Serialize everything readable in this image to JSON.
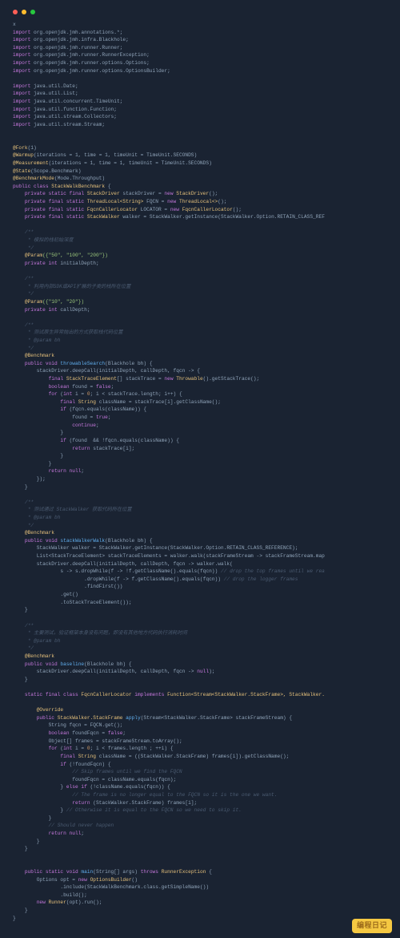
{
  "titlebar": {
    "dots": [
      "close",
      "min",
      "max"
    ]
  },
  "badge": "编程日记",
  "code": {
    "l00": "x",
    "imp": "import",
    "i01": " org.openjdk.jmh.annotations.*;",
    "i02": " org.openjdk.jmh.infra.Blackhole;",
    "i03": " org.openjdk.jmh.runner.Runner;",
    "i04": " org.openjdk.jmh.runner.RunnerException;",
    "i05": " org.openjdk.jmh.runner.options.Options;",
    "i06": " org.openjdk.jmh.runner.options.OptionsBuilder;",
    "i07": " java.util.Date;",
    "i08": " java.util.List;",
    "i09": " java.util.concurrent.TimeUnit;",
    "i10": " java.util.function.Function;",
    "i11": " java.util.stream.Collectors;",
    "i12": " java.util.stream.Stream;",
    "a_fork": "@Fork",
    "a_fork_v": "(1)",
    "a_warm": "@Warmup",
    "a_warm_v": "(iterations = 1, time = 1, timeUnit = TimeUnit.SECONDS)",
    "a_meas": "@Measurement",
    "a_meas_v": "(iterations = 1, time = 1, timeUnit = TimeUnit.SECONDS)",
    "a_state": "@State",
    "a_state_v": "(Scope.Benchmark)",
    "a_mode": "@BenchmarkMode",
    "a_mode_v": "(Mode.Throughput)",
    "cls_decl1": "public class",
    "cls_name": " StackWalkBenchmark",
    "f1a": "    private static final ",
    "f1b": "StackDriver",
    "f1c": " stackDriver = ",
    "f1d": "new ",
    "f1e": "StackDriver",
    "f1f": "();",
    "f2a": "    private final static ",
    "f2b": "ThreadLocal<String>",
    "f2c": " FQCN = ",
    "f2d": "new ",
    "f2e": "ThreadLocal<>",
    "f2f": "();",
    "f3a": "    private final static ",
    "f3b": "FqcnCallerLocator",
    "f3c": " LOCATOR = ",
    "f3d": "new ",
    "f3e": "FqcnCallerLocator",
    "f3f": "();",
    "f4a": "    private final static ",
    "f4b": "StackWalker",
    "f4c": " walker = StackWalker.getInstance(StackWalker.Option.RETAIN_CLASS_REF",
    "c1a": "    /**",
    "c1b": "     * 模拟的栈初始深度",
    "c1c": "     */",
    "p1a": "    @Param",
    "p1b": "({\"50\", \"100\", \"200\"})",
    "p1c": "    private int",
    "p1d": " initialDepth;",
    "c2a": "    /**",
    "c2b": "     * 利用内部SDK或API扩展的子类的栈所在位置",
    "c2c": "     */",
    "p2a": "    @Param",
    "p2b": "({\"10\", \"20\"})",
    "p2c": "    private int",
    "p2d": " callDepth;",
    "c3a": "    /**",
    "c3b": "     * 测试原生异常抛出的方式获取栈代码位置",
    "c3c": "     * @param bh",
    "c3d": "     */",
    "bench": "    @Benchmark",
    "m1a": "    public void ",
    "m1b": "throwableSearch",
    "m1c": "(Blackhole bh) {",
    "m1d": "        stackDriver.deepCall(initialDepth, callDepth, fqcn -> {",
    "m1e": "            final ",
    "m1e2": "StackTraceElement",
    "m1e3": "[] stackTrace = ",
    "m1e4": "new ",
    "m1e5": "Throwable",
    "m1e6": "().getStackTrace();",
    "m1f": "            boolean",
    "m1f2": " found = ",
    "m1f3": "false",
    "m1f4": ";",
    "m1g": "            for",
    "m1g2": " (",
    "m1g3": "int",
    "m1g4": " i = ",
    "m1g5": "0",
    "m1g6": "; i < stackTrace.length; i++) {",
    "m1h": "                final ",
    "m1h2": "String",
    "m1h3": " className = stackTrace[i].getClassName();",
    "m1i": "                if",
    "m1i2": " (fqcn.equals(className)) {",
    "m1j": "                    found = ",
    "m1j2": "true",
    "m1j3": ";",
    "m1k": "                    continue",
    "m1k2": ";",
    "m1l": "                }",
    "m1m": "                if",
    "m1m2": " (found  && !fqcn.equals(className)) {",
    "m1n": "                    return",
    "m1n2": " stackTrace[i];",
    "m1o": "                }",
    "m1p": "            }",
    "m1q": "            return null",
    "m1q2": ";",
    "m1r": "        });",
    "m1s": "    }",
    "c4a": "    /**",
    "c4b": "     * 测试通过 StackWalker 获取代码所在位置",
    "c4c": "     * @param bh",
    "c4d": "     */",
    "m2a": "    public void ",
    "m2b": "stackWalkerWalk",
    "m2c": "(Blackhole bh) {",
    "m2d": "        StackWalker walker = StackWalker.getInstance(StackWalker.Option.RETAIN_CLASS_REFERENCE);",
    "m2e": "        List<StackTraceElement> stackTraceElements = walker.walk(stackFrameStream -> stackFrameStream.map",
    "m2f": "        stackDriver.deepCall(initialDepth, callDepth, fqcn -> walker.walk(",
    "m2g": "                s -> s.dropWhile(f -> !f.getClassName().equals(fqcn))",
    "m2g_c": " // drop the top frames until we rea",
    "m2h": "                        .dropWhile(f -> f.getClassName().equals(fqcn))",
    "m2h_c": " // drop the logger frames",
    "m2i": "                        .findFirst())",
    "m2j": "                .get()",
    "m2k": "                .toStackTraceElement());",
    "m2l": "    }",
    "c5a": "    /**",
    "c5b": "     * 主要测试，验证框架本身没有问题，即没有其他地方代码执行消耗时间",
    "c5c": "     * @param bh",
    "c5d": "     */",
    "m3a": "    public void ",
    "m3b": "baseline",
    "m3c": "(Blackhole bh) {",
    "m3d": "        stackDriver.deepCall(initialDepth, callDepth, fqcn -> ",
    "m3d2": "null",
    "m3d3": ");",
    "m3e": "    }",
    "inn1": "    static final class ",
    "inn2": "FqcnCallerLocator",
    "inn3": " implements ",
    "inn4": "Function<Stream<StackWalker.StackFrame>, StackWalker.",
    "ov": "        @Override",
    "ap1": "        public ",
    "ap2": "StackWalker.StackFrame ",
    "ap3": "apply",
    "ap4": "(Stream<StackWalker.StackFrame> stackFrameStream) {",
    "ap5": "            String fqcn = FQCN.get();",
    "ap6": "            boolean",
    "ap6b": " foundFqcn = ",
    "ap6c": "false",
    "ap6d": ";",
    "ap7": "            Object[] frames = stackFrameStream.toArray();",
    "ap8": "            for",
    "ap8b": " (",
    "ap8c": "int",
    "ap8d": " i = ",
    "ap8e": "0",
    "ap8f": "; i < frames.length ; ++i) {",
    "ap9": "                final ",
    "ap9b": "String",
    "ap9c": " className = ((StackWalker.StackFrame) frames[i]).getClassName();",
    "ap10": "                if",
    "ap10b": " (!foundFqcn) {",
    "ap11": "                    // Skip frames until we find the FQCN",
    "ap12": "                    foundFqcn = className.equals(fqcn);",
    "ap13": "                } ",
    "ap13b": "else if",
    "ap13c": " (!className.equals(fqcn)) {",
    "ap14": "                    // The frame is no longer equal to the FQCN so it is the one we want.",
    "ap15": "                    return",
    "ap15b": " (StackWalker.StackFrame) frames[i];",
    "ap16": "                }",
    "ap16c": " // Otherwise it is equal to the FQCN so we need to skip it.",
    "ap17": "            }",
    "ap18": "            // Should never happen",
    "ap19": "            return null",
    "ap19b": ";",
    "ap20": "        }",
    "ap21": "    }",
    "mn1": "    public static void ",
    "mn2": "main",
    "mn3": "(String[] args) ",
    "mn4": "throws ",
    "mn5": "RunnerException",
    "mn6": " {",
    "mn7": "        Options opt = ",
    "mn7b": "new ",
    "mn7c": "OptionsBuilder",
    "mn7d": "()",
    "mn8": "                .include(StackWalkBenchmark.class.getSimpleName())",
    "mn9": "                .build();",
    "mn10": "        new ",
    "mn10b": "Runner",
    "mn10c": "(opt).run();",
    "mn11": "    }",
    "end": "}"
  }
}
